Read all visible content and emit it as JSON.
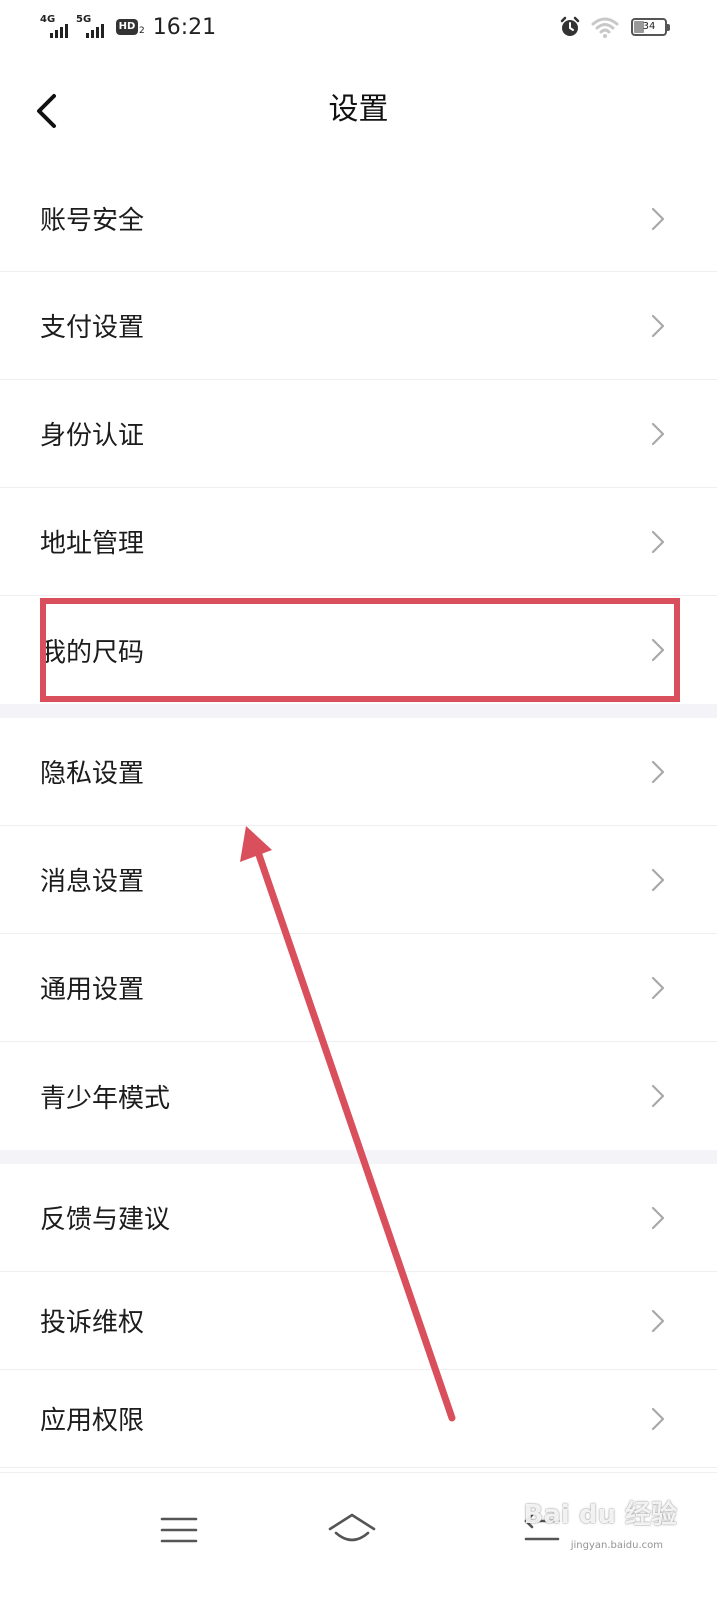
{
  "status_bar": {
    "network1": "4G",
    "network2": "5G",
    "hd_badge": "HD",
    "hd_sub": "2",
    "time": "16:21",
    "battery_level": "34",
    "battery_fraction": 0.34,
    "icons": [
      "alarm-icon",
      "wifi-icon",
      "battery-icon"
    ]
  },
  "header": {
    "title": "设置",
    "back_icon": "chevron-left-icon"
  },
  "groups": [
    {
      "items": [
        {
          "label": "账号安全"
        },
        {
          "label": "支付设置"
        },
        {
          "label": "身份认证"
        },
        {
          "label": "地址管理"
        },
        {
          "label": "我的尺码",
          "highlighted": true
        }
      ]
    },
    {
      "items": [
        {
          "label": "隐私设置"
        },
        {
          "label": "消息设置"
        },
        {
          "label": "通用设置"
        },
        {
          "label": "青少年模式"
        }
      ]
    },
    {
      "items": [
        {
          "label": "反馈与建议"
        },
        {
          "label": "投诉维权"
        },
        {
          "label": "应用权限"
        }
      ]
    }
  ],
  "nav_bar": {
    "icons": [
      "menu-icon",
      "home-icon",
      "back-icon"
    ]
  },
  "annotation": {
    "color": "#d9505c",
    "highlight_target": "我的尺码"
  },
  "watermark": {
    "text": "Bai du 经验",
    "sub": "jingyan.baidu.com"
  }
}
